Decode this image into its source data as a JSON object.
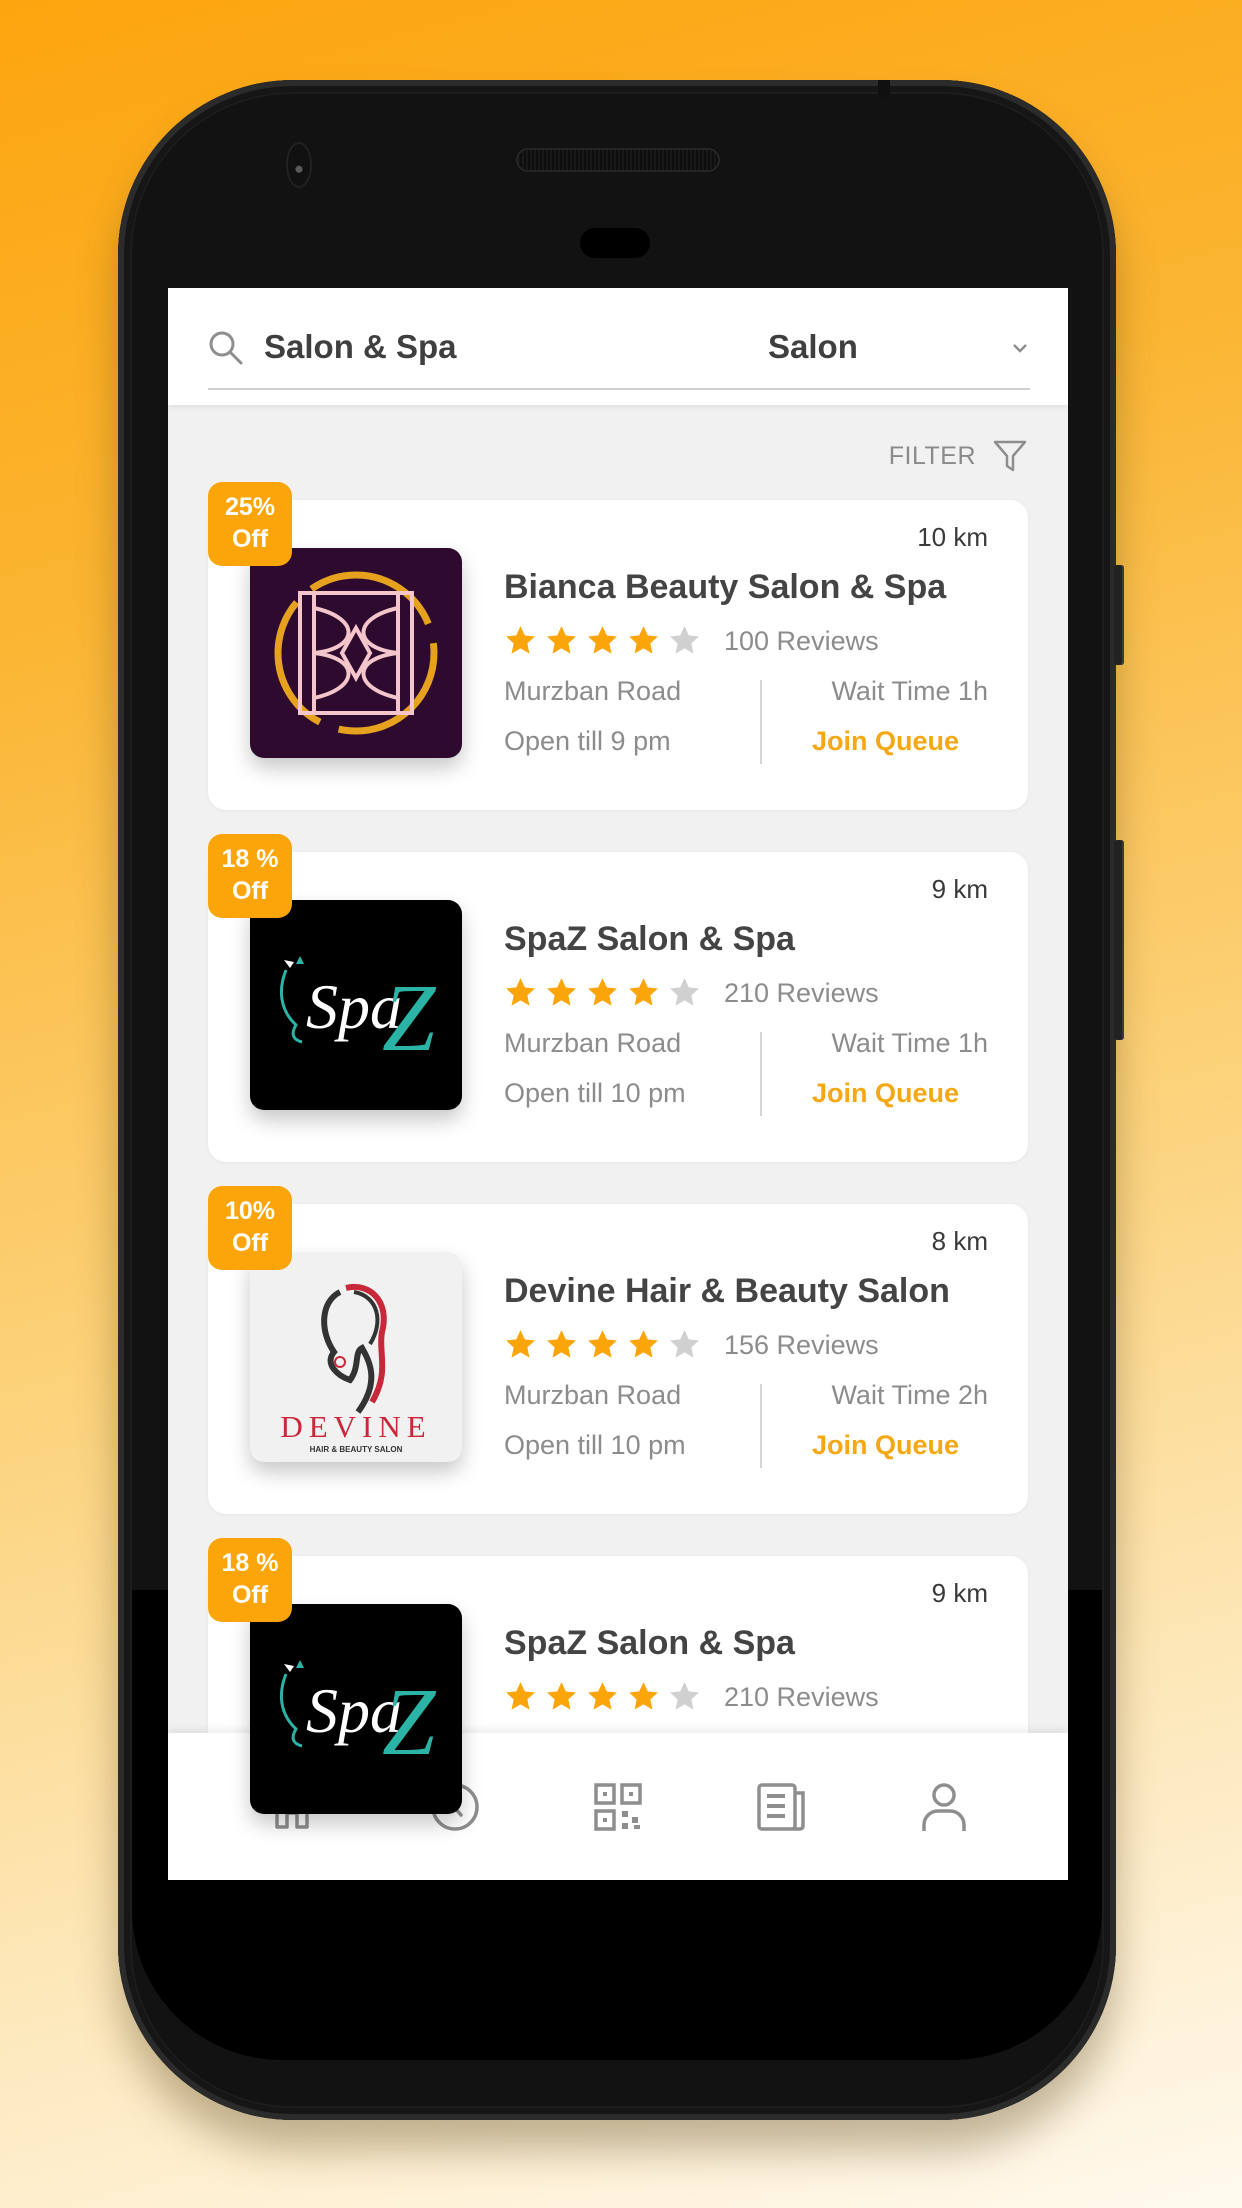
{
  "search": {
    "query": "Salon & Spa",
    "category": "Salon"
  },
  "filter": {
    "label": "FILTER"
  },
  "colors": {
    "accent": "#fca50a",
    "link": "#f4a814",
    "star_filled": "#fca50a",
    "star_empty": "#d0d0d0"
  },
  "listings": [
    {
      "discount_line1": "25%",
      "discount_line2": "Off",
      "distance": "10 km",
      "name": "Bianca Beauty Salon & Spa",
      "rating": 4,
      "rating_max": 5,
      "reviews": "100 Reviews",
      "address": "Murzban Road",
      "hours": "Open till 9 pm",
      "wait_time": "Wait Time 1h",
      "action": "Join Queue",
      "logo": "bianca-logo"
    },
    {
      "discount_line1": "18 %",
      "discount_line2": "Off",
      "distance": "9 km",
      "name": "SpaZ Salon & Spa",
      "rating": 4,
      "rating_max": 5,
      "reviews": "210 Reviews",
      "address": "Murzban Road",
      "hours": "Open till 10 pm",
      "wait_time": "Wait Time 1h",
      "action": "Join Queue",
      "logo": "spaz-logo"
    },
    {
      "discount_line1": "10%",
      "discount_line2": "Off",
      "distance": "8 km",
      "name": "Devine Hair & Beauty Salon",
      "rating": 4,
      "rating_max": 5,
      "reviews": "156 Reviews",
      "address": "Murzban Road",
      "hours": "Open till 10 pm",
      "wait_time": "Wait Time 2h",
      "action": "Join Queue",
      "logo": "devine-logo",
      "logo_text": "DEVINE",
      "logo_subtext": "HAIR & BEAUTY SALON"
    },
    {
      "discount_line1": "18 %",
      "discount_line2": "Off",
      "distance": "9 km",
      "name": "SpaZ Salon & Spa",
      "rating": 4,
      "rating_max": 5,
      "reviews": "210 Reviews",
      "logo": "spaz-logo"
    }
  ],
  "spaz_logo_text": {
    "s": "Spa",
    "z": "Z"
  },
  "bottom_nav": [
    {
      "icon": "home-icon",
      "label": "Home"
    },
    {
      "icon": "clock-icon",
      "label": "History"
    },
    {
      "icon": "qr-code-icon",
      "label": "Scan"
    },
    {
      "icon": "news-icon",
      "label": "News"
    },
    {
      "icon": "profile-icon",
      "label": "Profile"
    }
  ]
}
